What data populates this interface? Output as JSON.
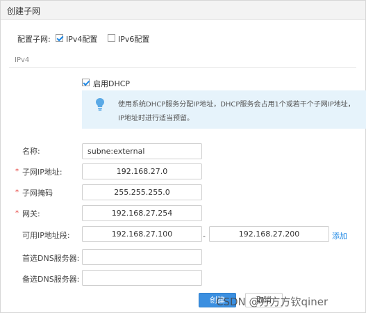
{
  "dialog": {
    "title": "创建子网"
  },
  "subnet_config": {
    "label": "配置子网:",
    "ipv4": {
      "label": "IPv4配置",
      "checked": true
    },
    "ipv6": {
      "label": "IPv6配置",
      "checked": false
    }
  },
  "section": {
    "title": "IPv4"
  },
  "dhcp": {
    "label": "启用DHCP",
    "checked": true,
    "info_line1": "使用系统DHCP服务分配IP地址，DHCP服务会占用1个或若干个子网IP地址，",
    "info_line2": "IP地址时进行适当预留。",
    "info_icon": "lightbulb-icon"
  },
  "form": {
    "name": {
      "label": "名称:",
      "value": "subne:external"
    },
    "subnet_ip": {
      "label": "子网IP地址:",
      "value": "192.168.27.0"
    },
    "subnet_mask": {
      "label": "子网掩码",
      "value": "255.255.255.0"
    },
    "gateway": {
      "label": "网关:",
      "value": "192.168.27.254"
    },
    "ip_range": {
      "label": "可用IP地址段:",
      "start": "192.168.27.100",
      "dash": "-",
      "end": "192.168.27.200",
      "add_link": "添加"
    },
    "dns_primary": {
      "label": "首选DNS服务器:",
      "value": ""
    },
    "dns_secondary": {
      "label": "备选DNS服务器:",
      "value": ""
    },
    "required_mark": "*"
  },
  "buttons": {
    "create": "创建",
    "cancel": "取消"
  },
  "watermark": "CSDN @方方方钦qiner",
  "colors": {
    "accent": "#1e88e5",
    "info_bg": "#e6f3fb",
    "required": "#e53935"
  }
}
